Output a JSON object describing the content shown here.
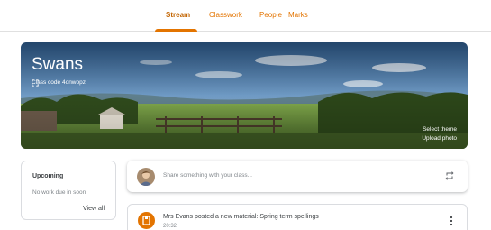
{
  "nav": {
    "tabs": [
      {
        "label": "Stream",
        "active": true
      },
      {
        "label": "Classwork",
        "active": false
      },
      {
        "label": "People",
        "active": false
      },
      {
        "label": "Marks",
        "active": false
      }
    ]
  },
  "banner": {
    "class_name": "Swans",
    "class_code": "Class code  4onwopz",
    "select_theme": "Select theme",
    "upload_photo": "Upload photo"
  },
  "upcoming": {
    "title": "Upcoming",
    "empty_text": "No work due in soon",
    "view_all": "View all"
  },
  "share": {
    "placeholder": "Share something with your class..."
  },
  "post": {
    "title": "Mrs Evans posted a new material: Spring term spellings",
    "time": "20:32"
  },
  "colors": {
    "accent": "#e37400",
    "accent_dark": "#c26401"
  }
}
